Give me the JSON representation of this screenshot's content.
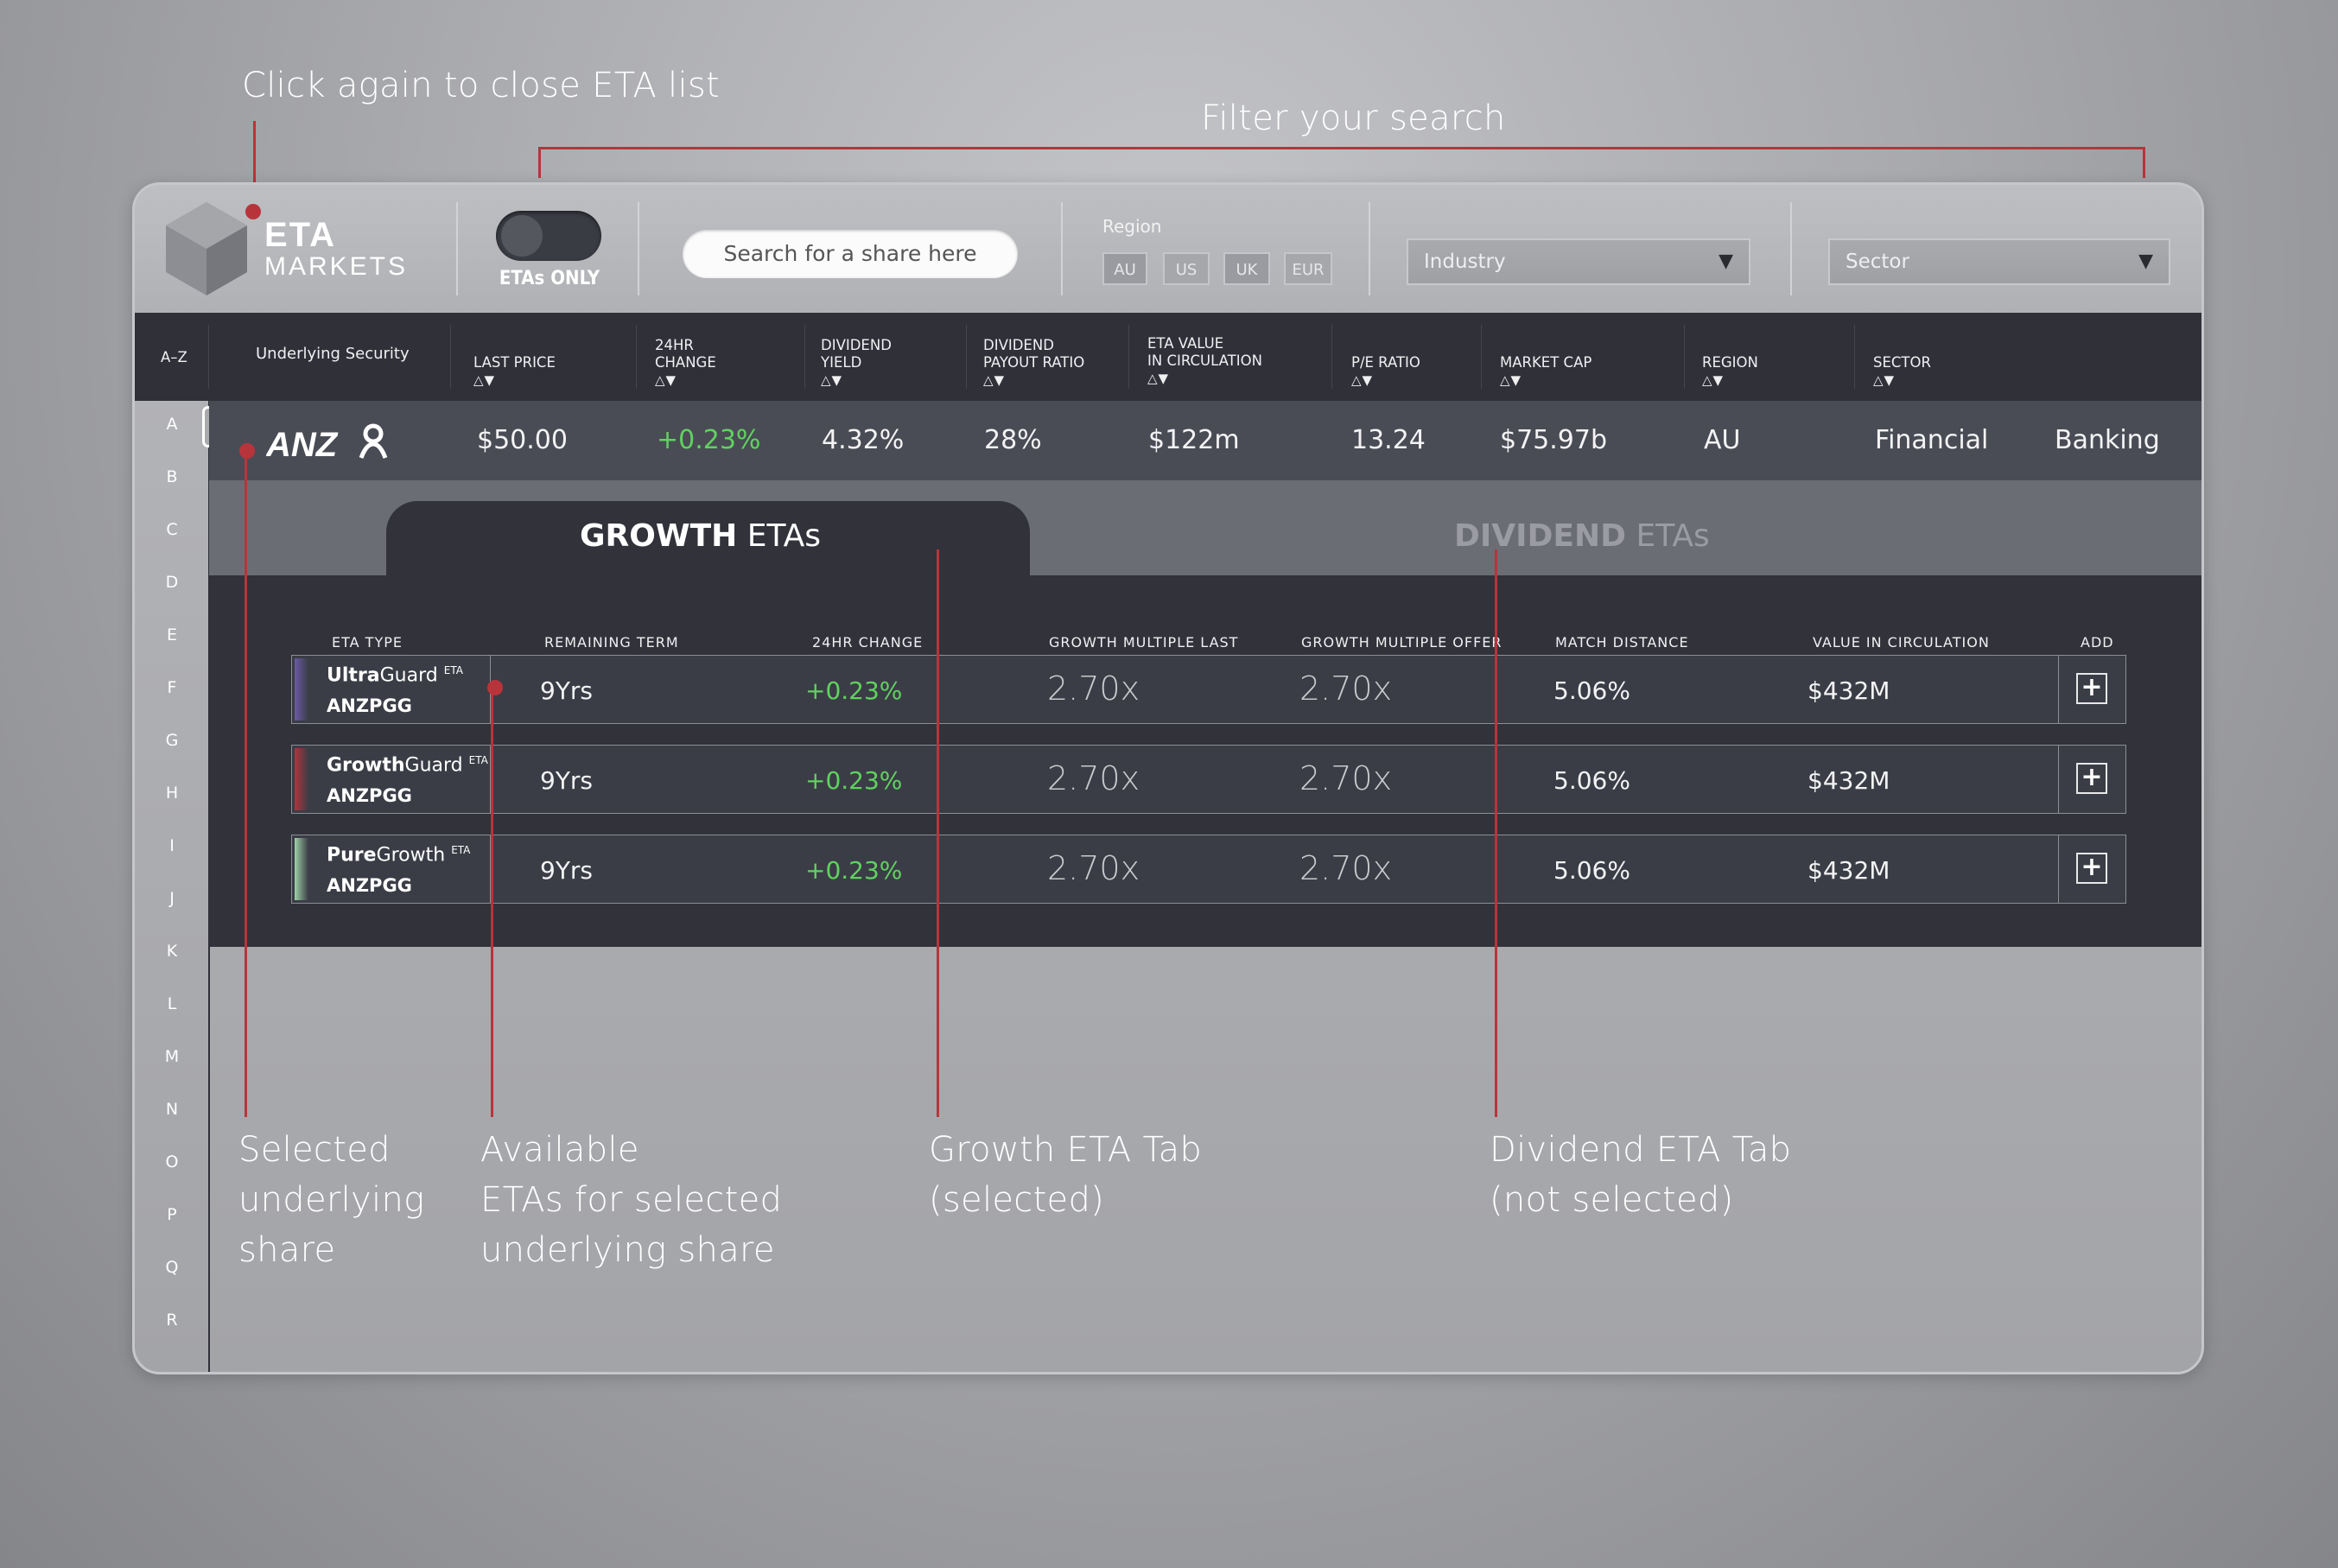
{
  "annotations": {
    "close_eta": "Click again to close ETA list",
    "filter": "Filter your search",
    "selected_underlying": [
      "Selected",
      "underlying",
      "share"
    ],
    "available_etas": [
      "Available",
      "ETAs for selected",
      "underlying share"
    ],
    "growth_tab": [
      "Growth ETA Tab",
      "(selected)"
    ],
    "dividend_tab": [
      "Dividend ETA Tab",
      "(not selected)"
    ]
  },
  "topbar": {
    "logo_line1": "ETA",
    "logo_line2": "MARKETS",
    "toggle_label": "ETAs ONLY",
    "search_placeholder": "Search for a share here",
    "region_label": "Region",
    "regions": [
      "AU",
      "US",
      "UK",
      "EUR"
    ],
    "industry": "Industry",
    "sector": "Sector"
  },
  "table_header": {
    "az": "A–Z",
    "underlying": "Underlying Security",
    "columns": [
      {
        "line1": "LAST PRICE",
        "line2": ""
      },
      {
        "line1": "24HR",
        "line2": "CHANGE"
      },
      {
        "line1": "DIVIDEND",
        "line2": "YIELD"
      },
      {
        "line1": "DIVIDEND",
        "line2": "PAYOUT RATIO"
      },
      {
        "line1": "ETA VALUE",
        "line2": "IN CIRCULATION"
      },
      {
        "line1": "P/E RATIO",
        "line2": ""
      },
      {
        "line1": "MARKET CAP",
        "line2": ""
      },
      {
        "line1": "REGION",
        "line2": ""
      },
      {
        "line1": "SECTOR",
        "line2": ""
      }
    ],
    "sort_arrows": "△▼"
  },
  "selected_share": {
    "logo": "ANZ",
    "last_price": "$50.00",
    "change": "+0.23%",
    "dividend_yield": "4.32%",
    "payout_ratio": "28%",
    "eta_value": "$122m",
    "pe_ratio": "13.24",
    "market_cap": "$75.97b",
    "region": "AU",
    "sector": "Financial",
    "industry": "Banking"
  },
  "alphabet": [
    "A",
    "B",
    "C",
    "D",
    "E",
    "F",
    "G",
    "H",
    "I",
    "J",
    "K",
    "L",
    "M",
    "N",
    "O",
    "P",
    "Q",
    "R"
  ],
  "tabs": {
    "growth_bold": "GROWTH",
    "growth_rest": "ETAs",
    "dividend_bold": "DIVIDEND",
    "dividend_rest": "ETAs"
  },
  "eta_headers": [
    "ETA TYPE",
    "REMAINING TERM",
    "24HR CHANGE",
    "GROWTH MULTIPLE LAST",
    "GROWTH MULTIPLE OFFER",
    "MATCH DISTANCE",
    "VALUE IN CIRCULATION",
    "ADD"
  ],
  "eta_rows": [
    {
      "name_bold": "Ultra",
      "name_rest": "Guard",
      "sup": "ETA",
      "code": "ANZPGG",
      "term": "9Yrs",
      "change": "+0.23%",
      "gm_last": "2.70x",
      "gm_offer": "2.70x",
      "match": "5.06%",
      "value": "$432M",
      "color": "#6a5aa8"
    },
    {
      "name_bold": "Growth",
      "name_rest": "Guard",
      "sup": "ETA",
      "code": "ANZPGG",
      "term": "9Yrs",
      "change": "+0.23%",
      "gm_last": "2.70x",
      "gm_offer": "2.70x",
      "match": "5.06%",
      "value": "$432M",
      "color": "#b2333c"
    },
    {
      "name_bold": "Pure",
      "name_rest": "Growth",
      "sup": "ETA",
      "code": "ANZPGG",
      "term": "9Yrs",
      "change": "+0.23%",
      "gm_last": "2.70x",
      "gm_offer": "2.70x",
      "match": "5.06%",
      "value": "$432M",
      "color": "#9ed2a8"
    }
  ],
  "add_symbol": "+"
}
